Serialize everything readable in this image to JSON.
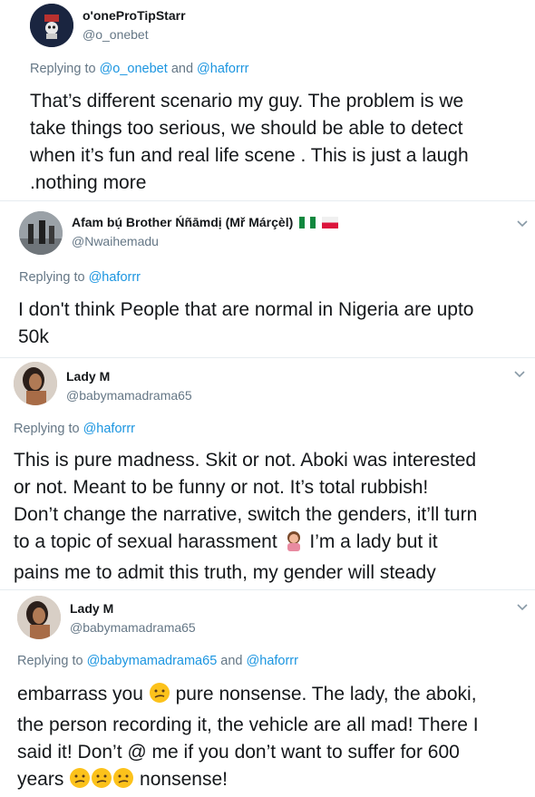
{
  "tweets": [
    {
      "name": "o'oneProTipStarr",
      "handle": "@o_onebet",
      "replying_prefix": "Replying to",
      "replying_a": "@o_onebet",
      "replying_and": "and",
      "replying_b": "@haforrr",
      "lines": [
        "That’s different scenario my guy. The problem is we",
        "take things too serious, we should be able to detect",
        "when it’s fun and real life scene . This is just a laugh",
        ".nothing more"
      ]
    },
    {
      "name": "Afam bụ́ Brother Ńñāmdị (Mř Márçèl)",
      "handle": "@Nwaihemadu",
      "replying_prefix": "Replying to",
      "replying_a": "@haforrr",
      "lines": [
        "I don't think People that are normal in Nigeria are upto",
        "50k"
      ]
    },
    {
      "name": "Lady M",
      "handle": "@babymamadrama65",
      "replying_prefix": "Replying to",
      "replying_a": "@haforrr",
      "lines": [
        "This is pure madness. Skit or not. Aboki was interested",
        "or not. Meant to be funny or not. It’s total rubbish!",
        "Don’t change the narrative, switch the genders, it’ll turn",
        "to a topic of sexual harassment",
        "I’m a lady but it",
        "pains me to admit this truth, my gender will steady"
      ]
    },
    {
      "name": "Lady M",
      "handle": "@babymamadrama65",
      "replying_prefix": "Replying to",
      "replying_a": "@babymamadrama65",
      "replying_and": "and",
      "replying_b": "@haforrr",
      "lines": [
        "embarrass you",
        "pure nonsense. The lady, the aboki,",
        "the person recording it, the vehicle are all mad! There I",
        "said it! Don’t @ me if you don’t want to suffer for 600",
        "years",
        "nonsense!"
      ]
    }
  ],
  "colors": {
    "link": "#1b95e0",
    "muted": "#657786",
    "text": "#14171a"
  },
  "icons": [
    "chevron-down-icon",
    "flag-nigeria-icon",
    "flag-poland-icon",
    "facepalm-woman-emoji",
    "confused-face-emoji"
  ]
}
